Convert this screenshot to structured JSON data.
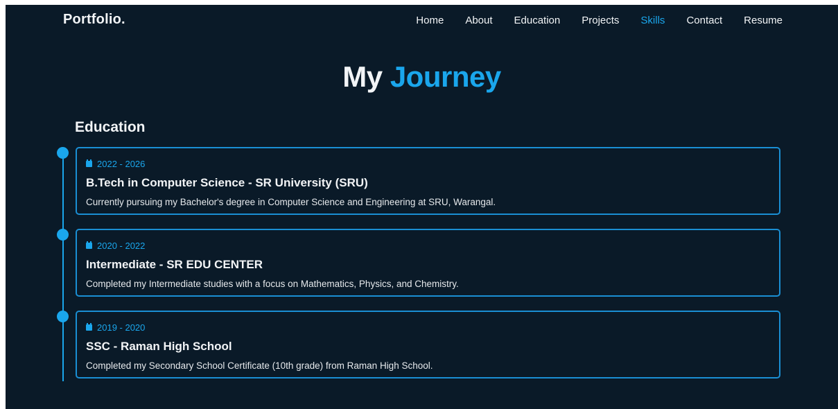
{
  "header": {
    "brand": "Portfolio.",
    "nav": [
      {
        "label": "Home",
        "active": false
      },
      {
        "label": "About",
        "active": false
      },
      {
        "label": "Education",
        "active": false
      },
      {
        "label": "Projects",
        "active": false
      },
      {
        "label": "Skills",
        "active": true
      },
      {
        "label": "Contact",
        "active": false
      },
      {
        "label": "Resume",
        "active": false
      }
    ]
  },
  "page": {
    "title_main": "My",
    "title_accent": "Journey"
  },
  "education": {
    "heading": "Education",
    "entries": [
      {
        "date": "2022 - 2026",
        "title": "B.Tech in Computer Science - SR University (SRU)",
        "description": "Currently pursuing my Bachelor's degree in Computer Science and Engineering at SRU, Warangal."
      },
      {
        "date": "2020 - 2022",
        "title": "Intermediate - SR EDU CENTER",
        "description": "Completed my Intermediate studies with a focus on Mathematics, Physics, and Chemistry."
      },
      {
        "date": "2019 - 2020",
        "title": "SSC - Raman High School",
        "description": "Completed my Secondary School Certificate (10th grade) from Raman High School."
      }
    ]
  },
  "colors": {
    "background": "#0a1a28",
    "accent": "#1aa6ec",
    "text": "#f2f4f6"
  },
  "icons": {
    "date": "calendar-icon"
  }
}
